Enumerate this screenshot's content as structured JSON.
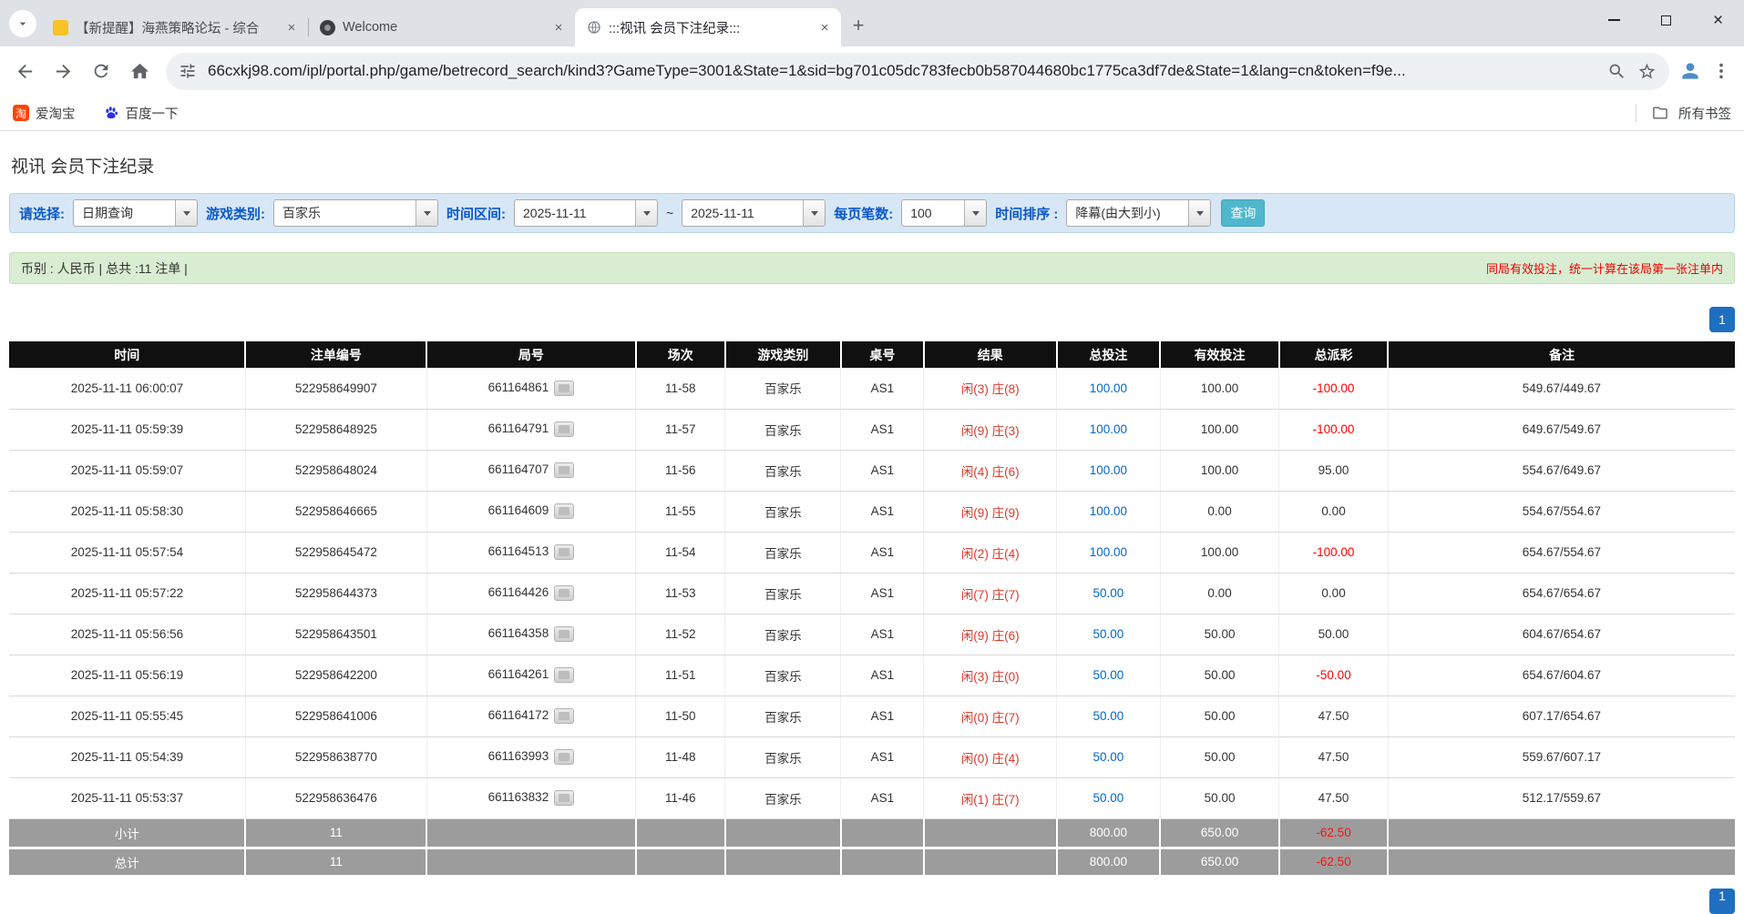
{
  "icons": {
    "close": "×",
    "plus": "+"
  },
  "browser": {
    "tabs": [
      {
        "title": "【新提醒】海燕策略论坛 - 综合"
      },
      {
        "title": "Welcome"
      },
      {
        "title": ":::视讯 会员下注纪录:::"
      }
    ],
    "url": "66cxkj98.com/ipl/portal.php/game/betrecord_search/kind3?GameType=3001&State=1&sid=bg701c05dc783fecb0b587044680bc1775ca3df7de&State=1&lang=cn&token=f9e...",
    "bookmarks": [
      {
        "label": "爱淘宝",
        "icon_char": "淘"
      },
      {
        "label": "百度一下"
      }
    ],
    "all_bookmarks": "所有书签"
  },
  "colors": {
    "filter_bg": "#d8e7f5",
    "summary_bg": "#d9edd2",
    "query_button": "#4fb7cd",
    "pagination_blue": "#1f6fc0",
    "link_blue": "#0066cc",
    "negative_red": "#ff0000",
    "result_red": "#e0372a",
    "header_black": "#101010",
    "sum_row_gray": "#9c9c9c"
  },
  "page": {
    "title": "视讯 会员下注纪录",
    "filters": {
      "select_label": "请选择:",
      "select_value": "日期查询",
      "game_type_label": "游戏类别:",
      "game_type_value": "百家乐",
      "date_range_label": "时间区间:",
      "date_from": "2025-11-11",
      "tilde": "~",
      "date_to": "2025-11-11",
      "page_size_label": "每页笔数:",
      "page_size_value": "100",
      "sort_label": "时间排序 :",
      "sort_value": "降幕(由大到小)",
      "query_button": "查询"
    },
    "summary_bar": {
      "left": "币别 : 人民币 | 总共 :11 注单 |",
      "right": "同局有效投注，统一计算在该局第一张注单内"
    },
    "pagination": {
      "current": "1"
    },
    "table": {
      "headers": [
        "时间",
        "注单编号",
        "局号",
        "场次",
        "游戏类别",
        "桌号",
        "结果",
        "总投注",
        "有效投注",
        "总派彩",
        "备注"
      ],
      "rows": [
        {
          "time": "2025-11-11 06:00:07",
          "bet_id": "522958649907",
          "round": "661164861",
          "session": "11-58",
          "game": "百家乐",
          "table": "AS1",
          "result_player": "闲(3)",
          "result_banker": "庄(8)",
          "total_bet": "100.00",
          "valid_bet": "100.00",
          "payout": "-100.00",
          "note": "549.67/449.67"
        },
        {
          "time": "2025-11-11 05:59:39",
          "bet_id": "522958648925",
          "round": "661164791",
          "session": "11-57",
          "game": "百家乐",
          "table": "AS1",
          "result_player": "闲(9)",
          "result_banker": "庄(3)",
          "total_bet": "100.00",
          "valid_bet": "100.00",
          "payout": "-100.00",
          "note": "649.67/549.67"
        },
        {
          "time": "2025-11-11 05:59:07",
          "bet_id": "522958648024",
          "round": "661164707",
          "session": "11-56",
          "game": "百家乐",
          "table": "AS1",
          "result_player": "闲(4)",
          "result_banker": "庄(6)",
          "total_bet": "100.00",
          "valid_bet": "100.00",
          "payout": "95.00",
          "note": "554.67/649.67"
        },
        {
          "time": "2025-11-11 05:58:30",
          "bet_id": "522958646665",
          "round": "661164609",
          "session": "11-55",
          "game": "百家乐",
          "table": "AS1",
          "result_player": "闲(9)",
          "result_banker": "庄(9)",
          "total_bet": "100.00",
          "valid_bet": "0.00",
          "payout": "0.00",
          "note": "554.67/554.67"
        },
        {
          "time": "2025-11-11 05:57:54",
          "bet_id": "522958645472",
          "round": "661164513",
          "session": "11-54",
          "game": "百家乐",
          "table": "AS1",
          "result_player": "闲(2)",
          "result_banker": "庄(4)",
          "total_bet": "100.00",
          "valid_bet": "100.00",
          "payout": "-100.00",
          "note": "654.67/554.67"
        },
        {
          "time": "2025-11-11 05:57:22",
          "bet_id": "522958644373",
          "round": "661164426",
          "session": "11-53",
          "game": "百家乐",
          "table": "AS1",
          "result_player": "闲(7)",
          "result_banker": "庄(7)",
          "total_bet": "50.00",
          "valid_bet": "0.00",
          "payout": "0.00",
          "note": "654.67/654.67"
        },
        {
          "time": "2025-11-11 05:56:56",
          "bet_id": "522958643501",
          "round": "661164358",
          "session": "11-52",
          "game": "百家乐",
          "table": "AS1",
          "result_player": "闲(9)",
          "result_banker": "庄(6)",
          "total_bet": "50.00",
          "valid_bet": "50.00",
          "payout": "50.00",
          "note": "604.67/654.67"
        },
        {
          "time": "2025-11-11 05:56:19",
          "bet_id": "522958642200",
          "round": "661164261",
          "session": "11-51",
          "game": "百家乐",
          "table": "AS1",
          "result_player": "闲(3)",
          "result_banker": "庄(0)",
          "total_bet": "50.00",
          "valid_bet": "50.00",
          "payout": "-50.00",
          "note": "654.67/604.67"
        },
        {
          "time": "2025-11-11 05:55:45",
          "bet_id": "522958641006",
          "round": "661164172",
          "session": "11-50",
          "game": "百家乐",
          "table": "AS1",
          "result_player": "闲(0)",
          "result_banker": "庄(7)",
          "total_bet": "50.00",
          "valid_bet": "50.00",
          "payout": "47.50",
          "note": "607.17/654.67"
        },
        {
          "time": "2025-11-11 05:54:39",
          "bet_id": "522958638770",
          "round": "661163993",
          "session": "11-48",
          "game": "百家乐",
          "table": "AS1",
          "result_player": "闲(0)",
          "result_banker": "庄(4)",
          "total_bet": "50.00",
          "valid_bet": "50.00",
          "payout": "47.50",
          "note": "559.67/607.17"
        },
        {
          "time": "2025-11-11 05:53:37",
          "bet_id": "522958636476",
          "round": "661163832",
          "session": "11-46",
          "game": "百家乐",
          "table": "AS1",
          "result_player": "闲(1)",
          "result_banker": "庄(7)",
          "total_bet": "50.00",
          "valid_bet": "50.00",
          "payout": "47.50",
          "note": "512.17/559.67"
        }
      ],
      "subtotal": {
        "label": "小计",
        "count": "11",
        "total_bet": "800.00",
        "valid_bet": "650.00",
        "payout": "-62.50"
      },
      "total": {
        "label": "总计",
        "count": "11",
        "total_bet": "800.00",
        "valid_bet": "650.00",
        "payout": "-62.50"
      }
    }
  }
}
